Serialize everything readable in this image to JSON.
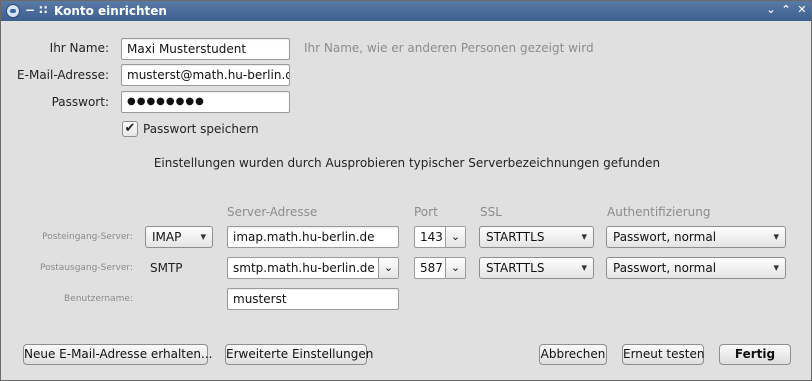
{
  "window": {
    "title": "Konto einrichten",
    "title_glyphs": [
      "−",
      "∷"
    ],
    "controls": [
      "⌄",
      "⌃",
      "✕"
    ]
  },
  "identity": {
    "name_label": "Ihr Name:",
    "name_value": "Maxi Musterstudent",
    "name_hint": "Ihr Name, wie er anderen Personen gezeigt wird",
    "email_label": "E-Mail-Adresse:",
    "email_value": "musterst@math.hu-berlin.de",
    "password_label": "Passwort:",
    "password_value": "●●●●●●●●",
    "remember_label": "Passwort speichern",
    "remember_checked": true
  },
  "status_message": "Einstellungen wurden durch Ausprobieren typischer Serverbezeichnungen gefunden",
  "server_table": {
    "headers": {
      "address": "Server-Adresse",
      "port": "Port",
      "ssl": "SSL",
      "auth": "Authentifizierung"
    },
    "incoming": {
      "label": "Posteingang-Server:",
      "protocol": "IMAP",
      "address": "imap.math.hu-berlin.de",
      "port": "143",
      "ssl": "STARTTLS",
      "auth": "Passwort, normal"
    },
    "outgoing": {
      "label": "Postausgang-Server:",
      "protocol": "SMTP",
      "address": "smtp.math.hu-berlin.de",
      "port": "587",
      "ssl": "STARTTLS",
      "auth": "Passwort, normal"
    },
    "username": {
      "label": "Benutzername:",
      "value": "musterst"
    }
  },
  "buttons": {
    "new_address": "Neue E-Mail-Adresse erhalten...",
    "advanced": "Erweiterte Einstellungen",
    "cancel": "Abbrechen",
    "retest": "Erneut testen",
    "done": "Fertig"
  }
}
